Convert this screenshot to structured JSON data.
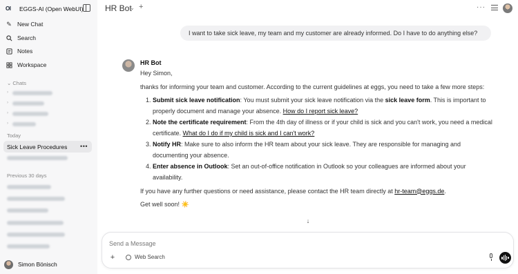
{
  "sidebar": {
    "logo": "OI",
    "app_title": "EGGS-AI (Open WebUI)",
    "nav": [
      {
        "label": "New Chat",
        "icon": "edit-icon"
      },
      {
        "label": "Search",
        "icon": "search-icon"
      },
      {
        "label": "Notes",
        "icon": "notes-icon"
      },
      {
        "label": "Workspace",
        "icon": "workspace-icon"
      }
    ],
    "chats_label": "Chats",
    "today_label": "Today",
    "active_chat": "Sick Leave Procedures",
    "active_chat_menu": "•••",
    "previous_label": "Previous 30 days",
    "user_name": "Simon Bönisch"
  },
  "topbar": {
    "model_name": "HR Bot",
    "more_icon": "more-horizontal-icon",
    "controls_icon": "sliders-icon"
  },
  "conversation": {
    "user_message": "I want to take sick leave, my team and my customer are already informed. Do I have to do anything else?",
    "bot_name": "HR Bot",
    "greeting": "Hey Simon,",
    "intro": "thanks for informing your team and customer. According to the current guidelines at eggs, you need to take a few more steps:",
    "steps": [
      {
        "title": "Submit sick leave notification",
        "text_before": ": You must submit your sick leave notification via the ",
        "bold_mid": "sick leave form",
        "text_after": ". This is important to properly document and manage your absence. ",
        "link": "How do I report sick leave?"
      },
      {
        "title": "Note the certificate requirement",
        "text_before": ": From the 4th day of illness or if your child is sick and you can't work, you need a medical certificate. ",
        "bold_mid": "",
        "text_after": "",
        "link": "What do I do if my child is sick and I can't work?"
      },
      {
        "title": "Notify HR",
        "text_before": ": Make sure to also inform the HR team about your sick leave. They are responsible for managing and documenting your absence.",
        "bold_mid": "",
        "text_after": "",
        "link": ""
      },
      {
        "title": "Enter absence in Outlook",
        "text_before": ": Set an out-of-office notification in Outlook so your colleagues are informed about your availability.",
        "bold_mid": "",
        "text_after": "",
        "link": ""
      }
    ],
    "contact_text": "If you have any further questions or need assistance, please contact the HR team directly at ",
    "contact_link": "hr-team@eggs.de",
    "contact_end": ".",
    "closing": "Get well soon! ☀️"
  },
  "composer": {
    "placeholder": "Send a Message",
    "value": "",
    "web_search_label": "Web Search"
  }
}
